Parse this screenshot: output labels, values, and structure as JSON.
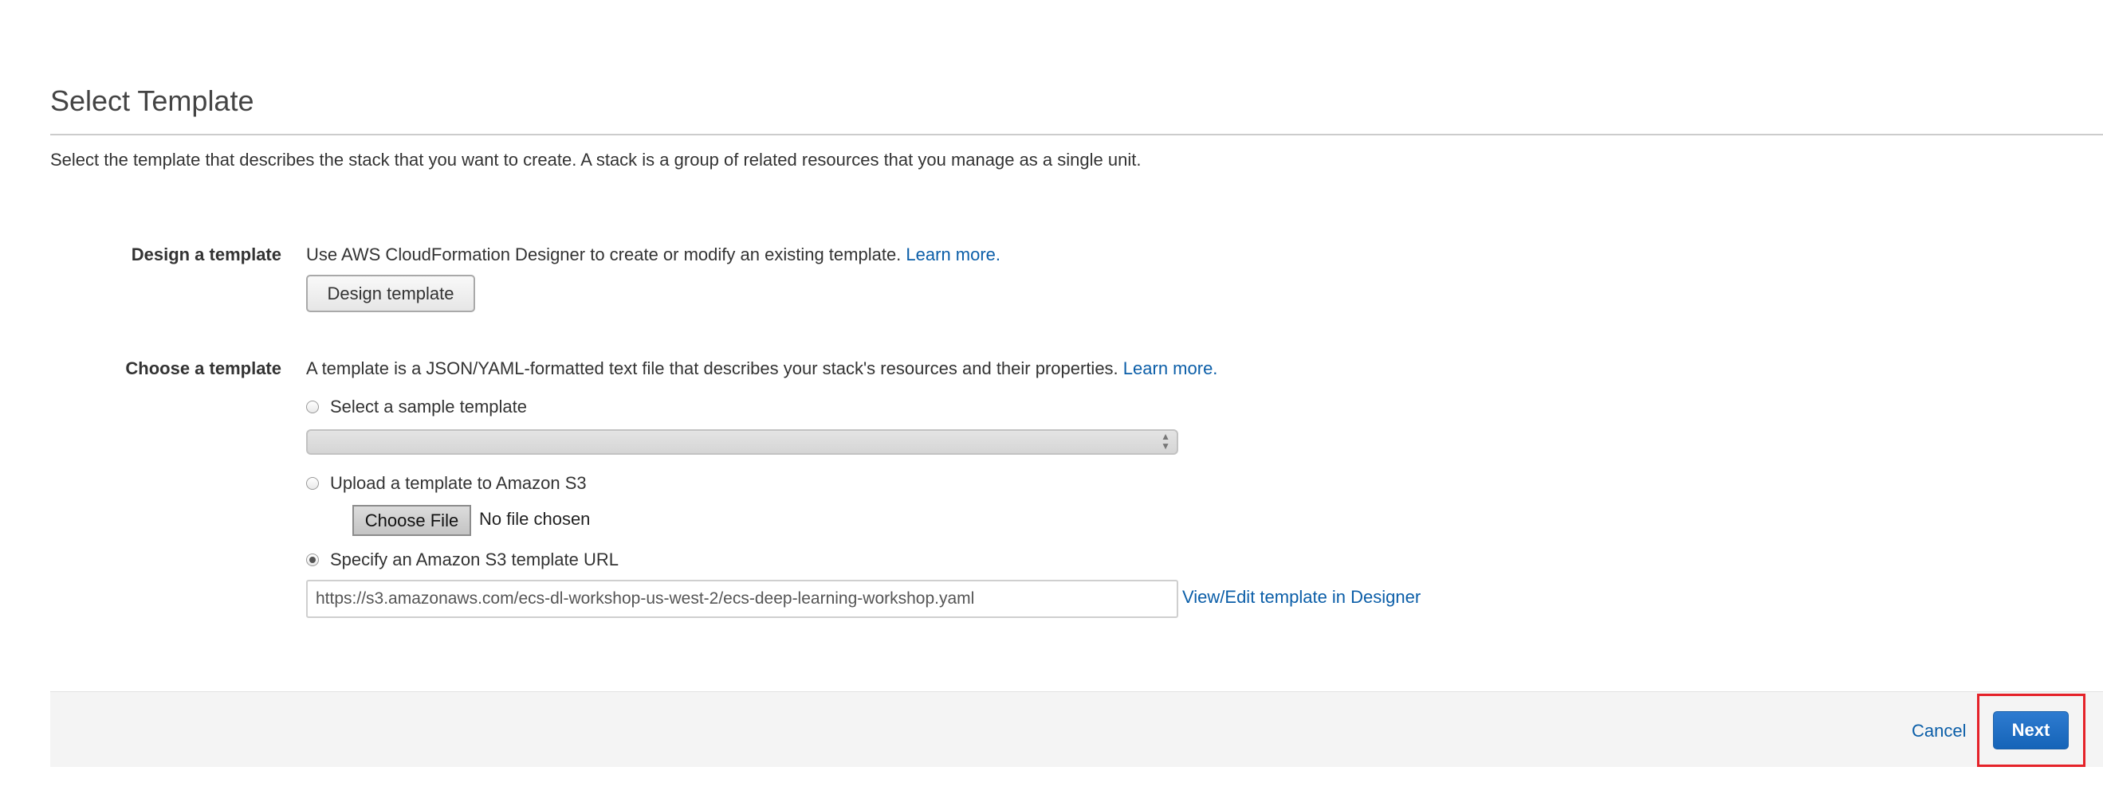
{
  "page": {
    "title": "Select Template",
    "intro": "Select the template that describes the stack that you want to create. A stack is a group of related resources that you manage as a single unit."
  },
  "design_section": {
    "label": "Design a template",
    "description": "Use AWS CloudFormation Designer to create or modify an existing template. ",
    "learn_more": "Learn more.",
    "button_label": "Design template"
  },
  "choose_section": {
    "label": "Choose a template",
    "description": "A template is a JSON/YAML-formatted text file that describes your stack's resources and their properties. ",
    "learn_more": "Learn more.",
    "options": {
      "sample": {
        "label": "Select a sample template",
        "selected": false,
        "select_value": ""
      },
      "upload": {
        "label": "Upload a template to Amazon S3",
        "selected": false,
        "file_button": "Choose File",
        "file_status": "No file chosen"
      },
      "url": {
        "label": "Specify an Amazon S3 template URL",
        "selected": true,
        "value": "https://s3.amazonaws.com/ecs-dl-workshop-us-west-2/ecs-deep-learning-workshop.yaml",
        "designer_link": "View/Edit template in Designer"
      }
    }
  },
  "footer": {
    "cancel_label": "Cancel",
    "next_label": "Next"
  },
  "colors": {
    "link": "#0b5ea8",
    "primary_button": "#1564b8",
    "highlight_border": "#e52229",
    "footer_bg": "#f4f4f4"
  }
}
